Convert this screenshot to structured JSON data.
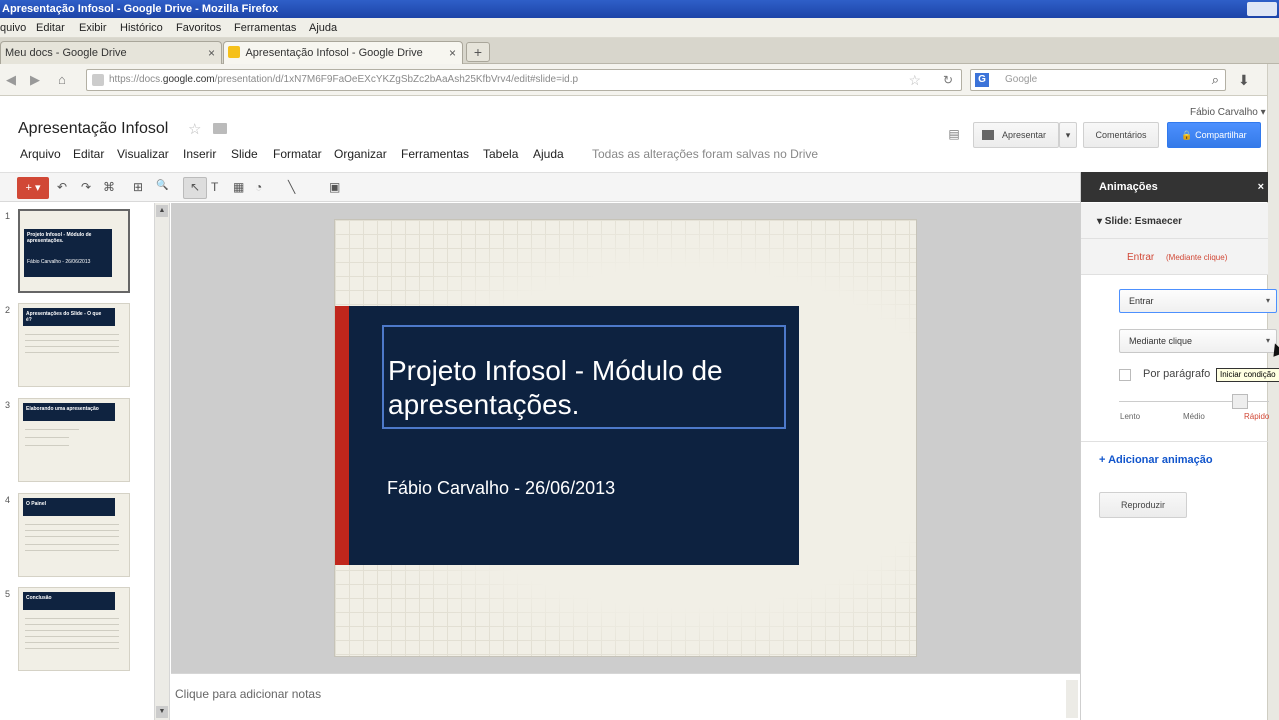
{
  "window": {
    "title": "Apresentação Infosol - Google Drive - Mozilla Firefox"
  },
  "firefox_menu": [
    "quivo",
    "Editar",
    "Exibir",
    "Histórico",
    "Favoritos",
    "Ferramentas",
    "Ajuda"
  ],
  "tabs": [
    {
      "label": "Meu docs - Google Drive",
      "close": "×"
    },
    {
      "label": "Apresentação Infosol - Google Drive",
      "close": "×"
    }
  ],
  "new_tab": "+",
  "nav": {
    "back": "◀",
    "forward": "▶",
    "url_prefix": "https://docs.",
    "url_domain": "google.com",
    "url_rest": "/presentation/d/1xN7M6F9FaOeEXcYKZgSbZc2bAaAsh25KfbVrv4/edit#slide=id.p",
    "search_placeholder": "Google",
    "search_engine": "G"
  },
  "docs": {
    "user": "Fábio Carvalho ▾",
    "title": "Apresentação Infosol",
    "menu": [
      "Arquivo",
      "Editar",
      "Visualizar",
      "Inserir",
      "Slide",
      "Formatar",
      "Organizar",
      "Ferramentas",
      "Tabela",
      "Ajuda"
    ],
    "saved_status": "Todas as alterações foram salvas no Drive",
    "buttons": {
      "present": "Apresentar",
      "present_arrow": "▾",
      "comments": "Comentários",
      "share": "🔒 Compartilhar"
    }
  },
  "toolbar": {
    "new": "+ ▾",
    "undo": "↶",
    "redo": "↷",
    "paint": "⌘",
    "zoom_fit": "⊞",
    "zoom": "🔍",
    "select": "↖",
    "textbox": "T",
    "image": "▦",
    "shape": "◔",
    "line": "╲",
    "comment": "▣"
  },
  "filmstrip": {
    "slides": [
      {
        "num": "1",
        "title": "Projeto Infosol - Módulo de apresentações.",
        "sub": "Fábio Carvalho - 26/06/2013"
      },
      {
        "num": "2",
        "title": "Apresentações do Slide - O que é?"
      },
      {
        "num": "3",
        "title": "Elaborando uma apresentação"
      },
      {
        "num": "4",
        "title": "O Painel"
      },
      {
        "num": "5",
        "title": "Conclusão"
      }
    ]
  },
  "slide": {
    "title": "Projeto Infosol - Módulo de apresentações.",
    "subtitle": "Fábio Carvalho - 26/06/2013"
  },
  "notes": {
    "placeholder": "Clique para adicionar notas"
  },
  "animations": {
    "header": "Animações",
    "close": "×",
    "slide_label": "▾ Slide: Esmaecer",
    "effect": "Entrar",
    "effect_trigger": "(Mediante clique)",
    "effect_select": "Entrar",
    "trigger_select": "Mediante clique",
    "by_paragraph": "Por parágrafo",
    "tooltip": "Iniciar condição",
    "speed": {
      "slow": "Lento",
      "medium": "Médio",
      "fast": "Rápido"
    },
    "add": "+ Adicionar animação",
    "play": "Reproduzir"
  }
}
